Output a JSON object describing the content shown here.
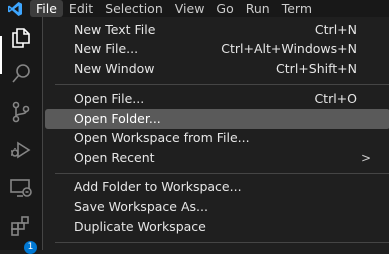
{
  "menubar": {
    "menus": [
      "File",
      "Edit",
      "Selection",
      "View",
      "Go",
      "Run",
      "Term"
    ]
  },
  "activity_bar": {
    "extensions_badge": "1"
  },
  "file_menu": {
    "new_text_file": {
      "label": "New Text File",
      "shortcut": "Ctrl+N"
    },
    "new_file": {
      "label": "New File...",
      "shortcut": "Ctrl+Alt+Windows+N"
    },
    "new_window": {
      "label": "New Window",
      "shortcut": "Ctrl+Shift+N"
    },
    "open_file": {
      "label": "Open File...",
      "shortcut": "Ctrl+O"
    },
    "open_folder": {
      "label": "Open Folder..."
    },
    "open_workspace": {
      "label": "Open Workspace from File..."
    },
    "open_recent": {
      "label": "Open Recent",
      "arrow": ">"
    },
    "add_folder": {
      "label": "Add Folder to Workspace..."
    },
    "save_workspace": {
      "label": "Save Workspace As..."
    },
    "duplicate_workspace": {
      "label": "Duplicate Workspace"
    }
  }
}
